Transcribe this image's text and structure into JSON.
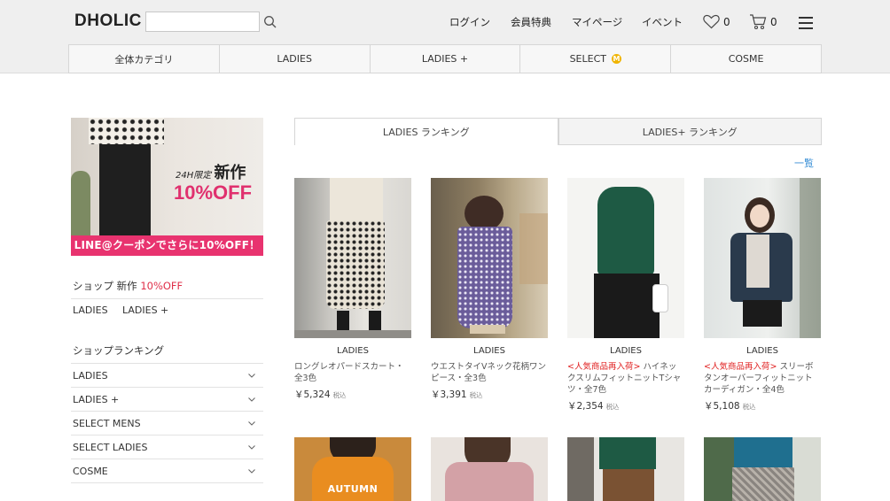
{
  "header": {
    "logo": "DHOLIC",
    "search_value": "",
    "nav": [
      "ログイン",
      "会員特典",
      "マイページ",
      "イベント"
    ],
    "wishlist_count": "0",
    "cart_count": "0"
  },
  "categories": [
    "全体カテゴリ",
    "LADIES",
    "LADIES +",
    "SELECT",
    "COSME"
  ],
  "select_badge": "M",
  "promo": {
    "line1_prefix": "24H限定",
    "line1_main": "新作",
    "line2": "10%OFF",
    "strip": "LINE@クーポンでさらに10%OFF！"
  },
  "sidebar": {
    "shop_new_label": "ショップ 新作",
    "shop_new_discount": "10%OFF",
    "shop_links": [
      "LADIES",
      "LADIES +"
    ],
    "ranking_title": "ショップランキング",
    "ranking_items": [
      "LADIES",
      "LADIES +",
      "SELECT MENS",
      "SELECT LADIES",
      "COSME"
    ]
  },
  "ranking_tabs": [
    "LADIES ランキング",
    "LADIES+ ランキング"
  ],
  "view_all": "一覧",
  "products": [
    {
      "brand": "LADIES",
      "hot": "",
      "name": "ロングレオパードスカート・全3色",
      "price": "￥5,324",
      "tax": "税込"
    },
    {
      "brand": "LADIES",
      "hot": "",
      "name": "ウエストタイVネック花柄ワンピース・全3色",
      "price": "￥3,391",
      "tax": "税込"
    },
    {
      "brand": "LADIES",
      "hot": "<人気商品再入荷>",
      "name": " ハイネックスリムフィットニットTシャツ・全7色",
      "price": "￥2,354",
      "tax": "税込"
    },
    {
      "brand": "LADIES",
      "hot": "<人気商品再入荷>",
      "name": " スリーボタンオーバーフィットニットカーディガン・全4色",
      "price": "￥5,108",
      "tax": "税込"
    }
  ],
  "row2_overlay": "AUTUMN",
  "colors": {
    "accent_pink": "#e8336f",
    "link_blue": "#3a8fd6",
    "hot_red": "#e02020",
    "badge_yellow": "#f0b400"
  }
}
